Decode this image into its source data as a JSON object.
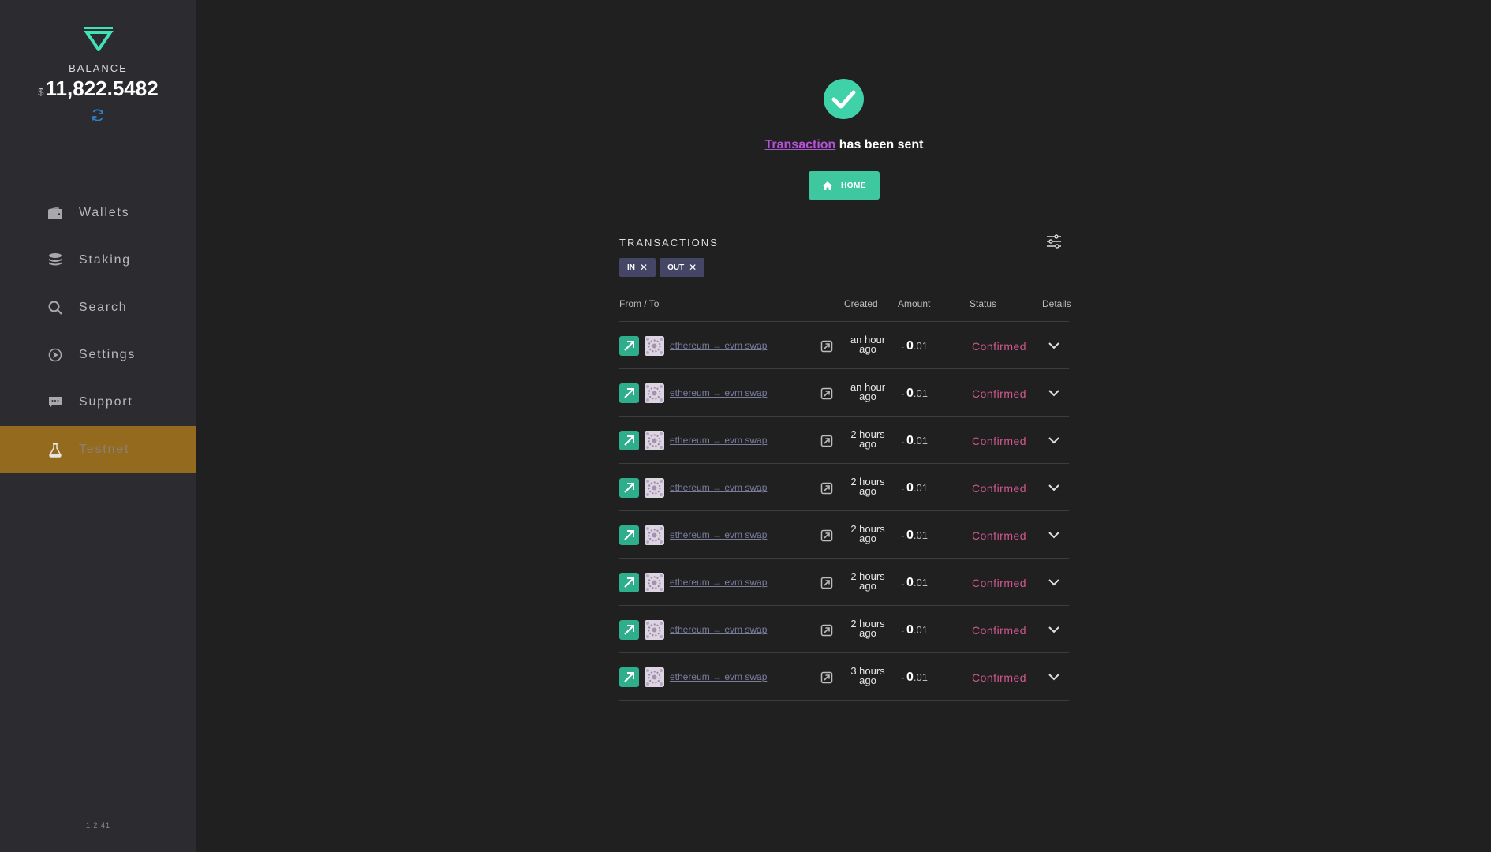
{
  "sidebar": {
    "balance_label": "BALANCE",
    "balance_currency": "$",
    "balance_value": "11,822.5482",
    "items": [
      {
        "label": "Wallets",
        "icon": "wallet-icon"
      },
      {
        "label": "Staking",
        "icon": "coin-stack-icon"
      },
      {
        "label": "Search",
        "icon": "search-icon"
      },
      {
        "label": "Settings",
        "icon": "settings-icon"
      },
      {
        "label": "Support",
        "icon": "chat-icon"
      },
      {
        "label": "Testnet",
        "icon": "flask-icon",
        "active": true
      }
    ],
    "version": "1.2.41"
  },
  "main": {
    "message_link": "Transaction",
    "message_text": " has been sent",
    "home_button": "HOME"
  },
  "transactions": {
    "title": "TRANSACTIONS",
    "filters": [
      "IN",
      "OUT"
    ],
    "columns": [
      "From / To",
      "Created",
      "Amount",
      "Status",
      "Details"
    ],
    "rows": [
      {
        "desc": "ethereum → evm swap",
        "created": "an hour ago",
        "amount_sign": "-",
        "amount_int": "0",
        "amount_frac": ".01",
        "status": "Confirmed"
      },
      {
        "desc": "ethereum → evm swap",
        "created": "an hour ago",
        "amount_sign": "-",
        "amount_int": "0",
        "amount_frac": ".01",
        "status": "Confirmed"
      },
      {
        "desc": "ethereum → evm swap",
        "created": "2 hours ago",
        "amount_sign": "-",
        "amount_int": "0",
        "amount_frac": ".01",
        "status": "Confirmed"
      },
      {
        "desc": "ethereum → evm swap",
        "created": "2 hours ago",
        "amount_sign": "-",
        "amount_int": "0",
        "amount_frac": ".01",
        "status": "Confirmed"
      },
      {
        "desc": "ethereum → evm swap",
        "created": "2 hours ago",
        "amount_sign": "-",
        "amount_int": "0",
        "amount_frac": ".01",
        "status": "Confirmed"
      },
      {
        "desc": "ethereum → evm swap",
        "created": "2 hours ago",
        "amount_sign": "-",
        "amount_int": "0",
        "amount_frac": ".01",
        "status": "Confirmed"
      },
      {
        "desc": "ethereum → evm swap",
        "created": "2 hours ago",
        "amount_sign": "-",
        "amount_int": "0",
        "amount_frac": ".01",
        "status": "Confirmed"
      },
      {
        "desc": "ethereum → evm swap",
        "created": "3 hours ago",
        "amount_sign": "-",
        "amount_int": "0",
        "amount_frac": ".01",
        "status": "Confirmed"
      }
    ]
  },
  "colors": {
    "accent": "#3fc7a0",
    "active_nav": "#946a1e",
    "status_confirmed": "#d2588e",
    "link_purple": "#b451d6"
  }
}
